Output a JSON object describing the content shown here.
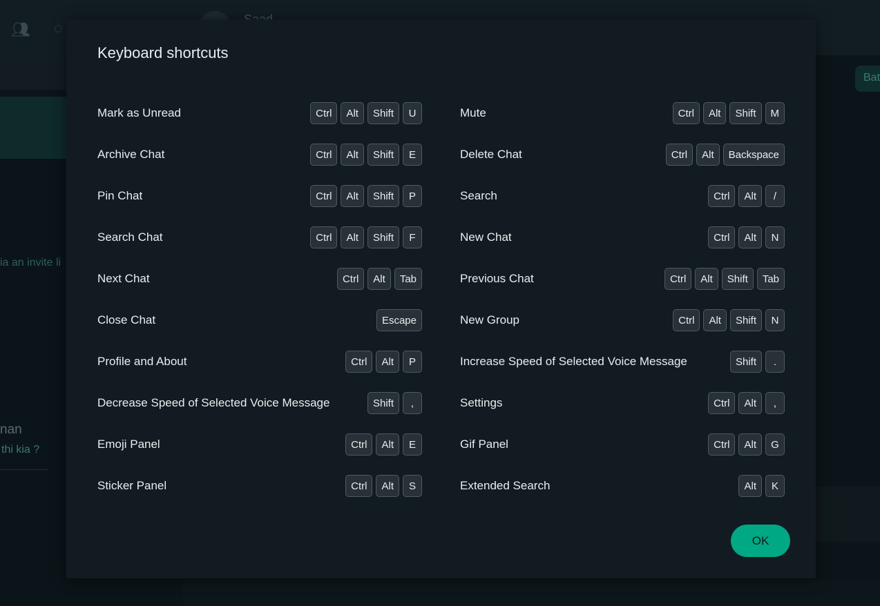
{
  "background": {
    "header_name": "Saad",
    "chip_label": "Bat",
    "invite_text": "ia an invite li",
    "chat_name": "nan",
    "chat_preview": "thi kia ?"
  },
  "dialog": {
    "title": "Keyboard shortcuts",
    "ok_label": "OK",
    "accent_color": "#00a884",
    "left_column": [
      {
        "label": "Mark as Unread",
        "keys": [
          "Ctrl",
          "Alt",
          "Shift",
          "U"
        ]
      },
      {
        "label": "Archive Chat",
        "keys": [
          "Ctrl",
          "Alt",
          "Shift",
          "E"
        ]
      },
      {
        "label": "Pin Chat",
        "keys": [
          "Ctrl",
          "Alt",
          "Shift",
          "P"
        ]
      },
      {
        "label": "Search Chat",
        "keys": [
          "Ctrl",
          "Alt",
          "Shift",
          "F"
        ]
      },
      {
        "label": "Next Chat",
        "keys": [
          "Ctrl",
          "Alt",
          "Tab"
        ]
      },
      {
        "label": "Close Chat",
        "keys": [
          "Escape"
        ]
      },
      {
        "label": "Profile and About",
        "keys": [
          "Ctrl",
          "Alt",
          "P"
        ]
      },
      {
        "label": "Decrease Speed of Selected Voice Message",
        "keys": [
          "Shift",
          ","
        ]
      },
      {
        "label": "Emoji Panel",
        "keys": [
          "Ctrl",
          "Alt",
          "E"
        ]
      },
      {
        "label": "Sticker Panel",
        "keys": [
          "Ctrl",
          "Alt",
          "S"
        ]
      }
    ],
    "right_column": [
      {
        "label": "Mute",
        "keys": [
          "Ctrl",
          "Alt",
          "Shift",
          "M"
        ]
      },
      {
        "label": "Delete Chat",
        "keys": [
          "Ctrl",
          "Alt",
          "Backspace"
        ]
      },
      {
        "label": "Search",
        "keys": [
          "Ctrl",
          "Alt",
          "/"
        ]
      },
      {
        "label": "New Chat",
        "keys": [
          "Ctrl",
          "Alt",
          "N"
        ]
      },
      {
        "label": "Previous Chat",
        "keys": [
          "Ctrl",
          "Alt",
          "Shift",
          "Tab"
        ]
      },
      {
        "label": "New Group",
        "keys": [
          "Ctrl",
          "Alt",
          "Shift",
          "N"
        ]
      },
      {
        "label": "Increase Speed of Selected Voice Message",
        "keys": [
          "Shift",
          "."
        ]
      },
      {
        "label": "Settings",
        "keys": [
          "Ctrl",
          "Alt",
          ","
        ]
      },
      {
        "label": "Gif Panel",
        "keys": [
          "Ctrl",
          "Alt",
          "G"
        ]
      },
      {
        "label": "Extended Search",
        "keys": [
          "Alt",
          "K"
        ]
      }
    ]
  }
}
